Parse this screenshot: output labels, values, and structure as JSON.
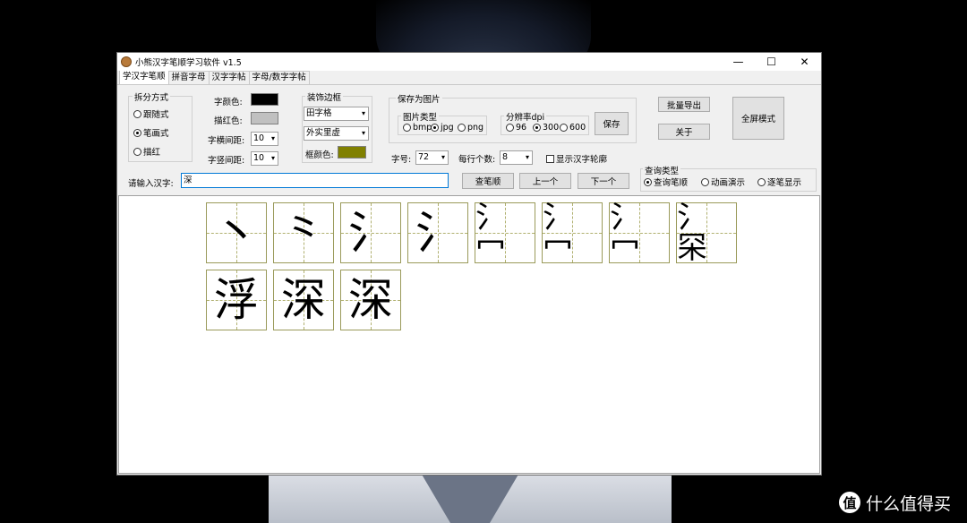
{
  "window": {
    "title": "小熊汉字笔顺学习软件 v1.5",
    "controls": [
      "—",
      "☐",
      "✕"
    ]
  },
  "tabs": [
    "学汉字笔顺",
    "拼音字母",
    "汉字字帖",
    "字母/数字字帖"
  ],
  "split": {
    "title": "拆分方式",
    "options": [
      "跟随式",
      "笔画式",
      "描红"
    ],
    "selected": "笔画式"
  },
  "colors_panel": {
    "char_color_label": "字颜色:",
    "char_color": "#000000",
    "trace_color_label": "描红色:",
    "trace_color": "#c0c0c0",
    "h_spacing_label": "字横间距:",
    "h_spacing": "10",
    "v_spacing_label": "字竖间距:",
    "v_spacing": "10"
  },
  "frame": {
    "title": "装饰边框",
    "grid": "田字格",
    "line_style": "外实里虚",
    "frame_color_label": "框颜色:",
    "frame_color": "#808000"
  },
  "save_image": {
    "title": "保存为图片",
    "type_title": "图片类型",
    "types": [
      "bmp",
      "jpg",
      "png"
    ],
    "type_selected": "jpg",
    "dpi_title": "分辨率dpi",
    "dpis": [
      "96",
      "300",
      "600"
    ],
    "dpi_selected": "300",
    "save_button": "保存"
  },
  "batch_export": "批量导出",
  "about": "关于",
  "fullscreen": "全屏模式",
  "font_size_label": "字号:",
  "font_size": "72",
  "per_row_label": "每行个数:",
  "per_row": "8",
  "show_outline": "显示汉字轮廓",
  "input": {
    "label": "请输入汉字:",
    "value": "深"
  },
  "buttons": {
    "lookup": "查笔顺",
    "prev": "上一个",
    "next": "下一个"
  },
  "query": {
    "title": "查询类型",
    "options": [
      "查询笔顺",
      "动画演示",
      "逐笔显示"
    ],
    "selected": "查询笔顺"
  },
  "strokes": [
    "丶",
    "⺀",
    "氵",
    "氵",
    "氵冖",
    "氵冖",
    "氵冖",
    "氵罙",
    "浮",
    "深",
    "深"
  ],
  "watermark": {
    "logo": "值",
    "text": "什么值得买"
  }
}
